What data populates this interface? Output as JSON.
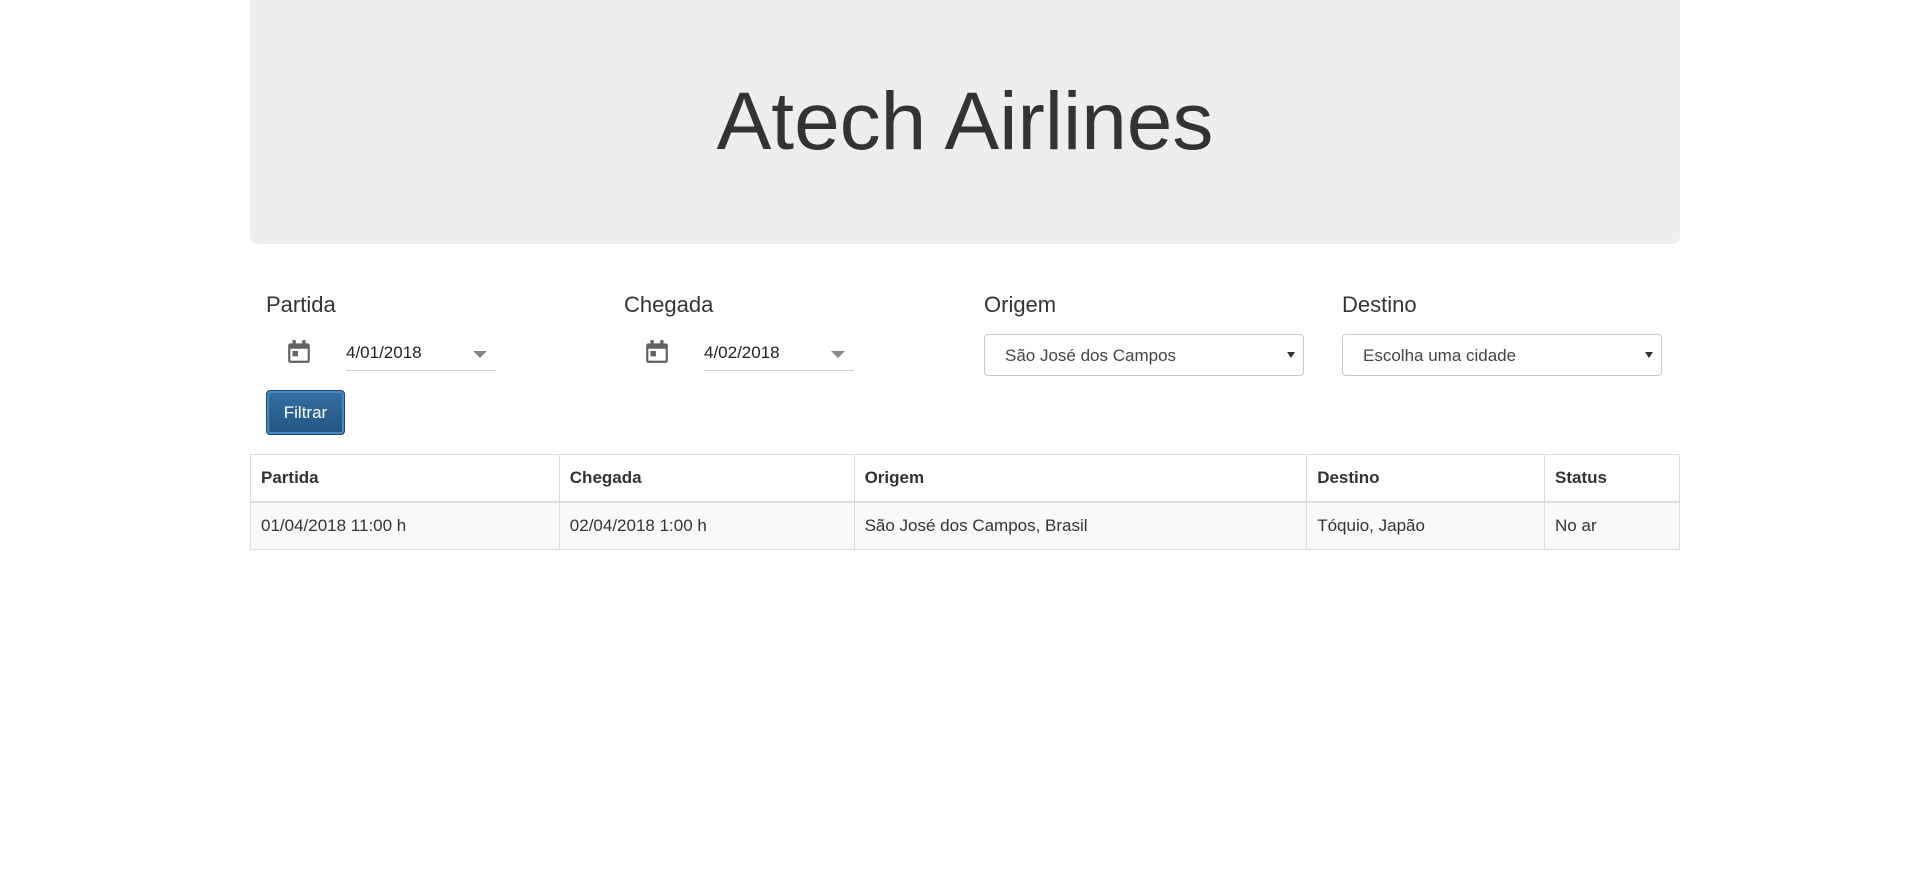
{
  "header": {
    "title": "Atech Airlines"
  },
  "filters": {
    "partida": {
      "label": "Partida",
      "value": "4/01/2018"
    },
    "chegada": {
      "label": "Chegada",
      "value": "4/02/2018"
    },
    "origem": {
      "label": "Origem",
      "selected": "São José dos Campos"
    },
    "destino": {
      "label": "Destino",
      "selected": "Escolha uma cidade"
    },
    "button_label": "Filtrar"
  },
  "table": {
    "headers": [
      "Partida",
      "Chegada",
      "Origem",
      "Destino",
      "Status"
    ],
    "rows": [
      [
        "01/04/2018 11:00 h",
        "02/04/2018 1:00 h",
        "São José dos Campos, Brasil",
        "Tóquio, Japão",
        "No ar"
      ]
    ]
  },
  "colors": {
    "jumbotron_bg": "#eeeeee",
    "button_bg": "#2a5f8f"
  }
}
